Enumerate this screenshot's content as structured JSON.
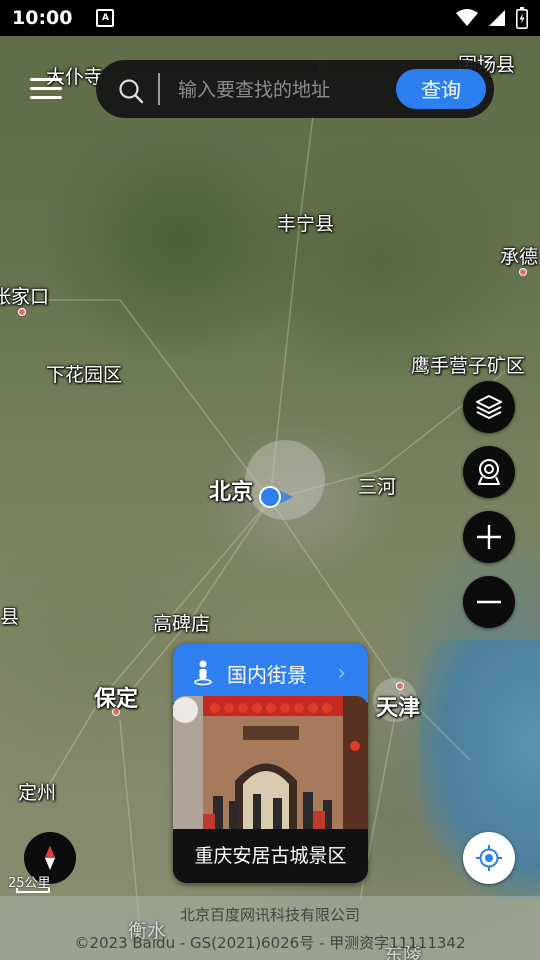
{
  "status_bar": {
    "time": "10:00",
    "notification_badge": "A",
    "icons": [
      "wifi-icon",
      "signal-icon",
      "battery-icon"
    ]
  },
  "search": {
    "placeholder": "输入要查找的地址",
    "value": "",
    "button_label": "查询"
  },
  "map": {
    "labels": {
      "beijing": "北京",
      "fengning": "丰宁县",
      "chengde": "承德",
      "zhangjiakou": "张家口",
      "xiahuayuan": "下花园区",
      "yingshouyingzi": "鹰手营子矿区",
      "sanhe": "三河",
      "gaobeidian": "高碑店",
      "baoding": "保定",
      "tianjin": "天津",
      "dingzhou": "定州",
      "hengshui": "衡水",
      "weichang": "围场县",
      "dapusi": "大仆寺",
      "xian_left": "县",
      "donglu": "东陵"
    },
    "colors": {
      "user_location": "#2d7ff0",
      "city_dot": "#e36b6b",
      "accent": "#2f7ff0"
    }
  },
  "controls": {
    "layers": "layers-icon",
    "street_view": "camera-icon",
    "zoom_in": "plus-icon",
    "zoom_out": "minus-icon",
    "locate": "locate-icon",
    "compass": "compass-icon"
  },
  "street_view_card": {
    "title": "国内街景",
    "caption": "重庆安居古城景区"
  },
  "scale": {
    "label": "25公里"
  },
  "footer": {
    "company": "北京百度网讯科技有限公司",
    "copyright": "©2023 Baidu - GS(2021)6026号 - 甲测资字11111342"
  }
}
